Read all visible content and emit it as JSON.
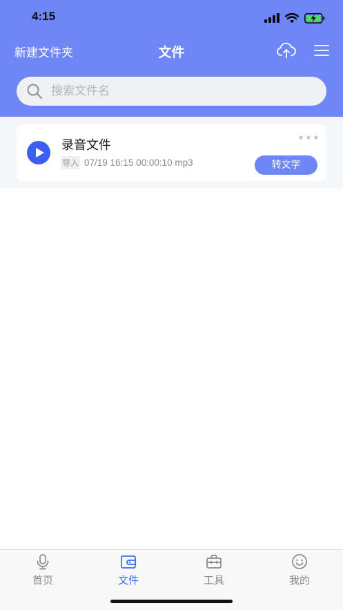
{
  "status_bar": {
    "time": "4:15",
    "icons": [
      "signal-icon",
      "wifi-icon",
      "battery-charging-icon"
    ]
  },
  "nav": {
    "left_action": "新建文件夹",
    "title": "文件",
    "right_icons": [
      "cloud-upload-icon",
      "menu-icon"
    ]
  },
  "search": {
    "placeholder": "搜索文件名",
    "value": ""
  },
  "files": [
    {
      "name": "录音文件",
      "tag": "导入",
      "meta": "07/19 16:15 00:00:10 mp3",
      "action_label": "转文字",
      "icon": "play-icon"
    }
  ],
  "tabs": [
    {
      "label": "首页",
      "icon": "microphone-icon",
      "active": false
    },
    {
      "label": "文件",
      "icon": "folder-icon",
      "active": true
    },
    {
      "label": "工具",
      "icon": "toolbox-icon",
      "active": false
    },
    {
      "label": "我的",
      "icon": "smiley-icon",
      "active": false
    }
  ],
  "colors": {
    "accent": "#6f86f7",
    "tab_active": "#3f6df3",
    "play_icon": "#3b5ff5",
    "tab_inactive": "#8a8a8a"
  }
}
